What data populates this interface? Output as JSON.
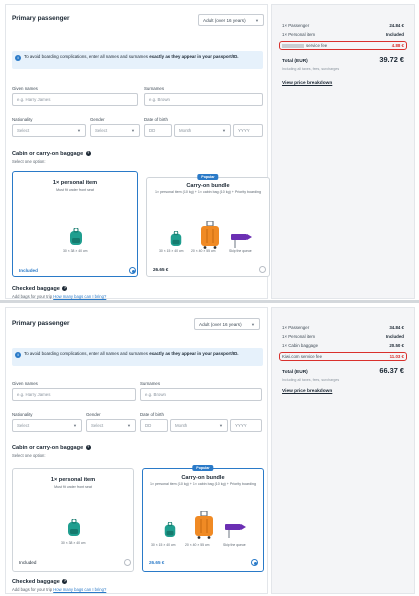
{
  "colors": {
    "accent": "#2a7ac8",
    "highlight": "#d9302c",
    "sidebar_bg": "#f4f5f7"
  },
  "icons": [
    "info-icon",
    "help-icon",
    "backpack-icon",
    "trolley-icon",
    "queue-tag-icon",
    "chevron-down-icon"
  ],
  "panels": [
    {
      "form": {
        "section_title": "Primary passenger",
        "age_select": "Adult (over 16 years)",
        "info_text_pre": "To avoid boarding complications, enter all names and surnames ",
        "info_text_bold": "exactly as they appear in your passport/ID.",
        "given_names_label": "Given names",
        "given_names_placeholder": "e.g. Harry James",
        "surnames_label": "Surnames",
        "surnames_placeholder": "e.g. Brown",
        "nationality_label": "Nationality",
        "nationality_value": "Select",
        "gender_label": "Gender",
        "gender_value": "Select",
        "dob_label": "Date of birth",
        "dob_day": "DD",
        "dob_month": "Month",
        "dob_year": "YYYY",
        "cabin_title": "Cabin or carry-on baggage",
        "cabin_sub": "Select one option:",
        "options": [
          {
            "title": "1× personal item",
            "desc": "Must fit under front seat",
            "dims": "30 × 38 × 40 cm",
            "status": "Included"
          },
          {
            "badge": "Popular",
            "title": "Carry-on bundle",
            "desc": "1× personal item (10 kg) + 1× cabin bag (10 kg) + Priority boarding",
            "dims1": "30 × 15 × 40 cm",
            "dims2": "20 × 40 × 55 cm",
            "dims3": "Skip the queue",
            "price": "26.65 €"
          }
        ],
        "checked_title": "Checked baggage",
        "checked_sub": "Add bags for your trip",
        "checked_link": "How many bags can I bring?"
      },
      "summary": {
        "rows": [
          {
            "label": "1× Passenger",
            "value": "24.84 €"
          },
          {
            "label": "1× Personal item",
            "value": "Included"
          }
        ],
        "fee_label": "service fee",
        "fee_value": "4.88 €",
        "total_label": "Total (EUR)",
        "total_value": "39.72 €",
        "total_sub": "Including all taxes, fees, surcharges",
        "breakdown_link": "View price breakdown"
      }
    },
    {
      "form": {
        "section_title": "Primary passenger",
        "age_select": "Adult (over 16 years)",
        "info_text_pre": "To avoid boarding complications, enter all names and surnames ",
        "info_text_bold": "exactly as they appear in your passport/ID.",
        "given_names_label": "Given names",
        "given_names_placeholder": "e.g. Harry James",
        "surnames_label": "Surnames",
        "surnames_placeholder": "e.g. Brown",
        "nationality_label": "Nationality",
        "nationality_value": "Select",
        "gender_label": "Gender",
        "gender_value": "Select",
        "dob_label": "Date of birth",
        "dob_day": "DD",
        "dob_month": "Month",
        "dob_year": "YYYY",
        "cabin_title": "Cabin or carry-on baggage",
        "cabin_sub": "Select one option:",
        "options": [
          {
            "title": "1× personal item",
            "desc": "Must fit under front seat",
            "dims": "30 × 38 × 40 cm",
            "status": "Included"
          },
          {
            "badge": "Popular",
            "title": "Carry-on bundle",
            "desc": "1× personal item (10 kg) + 1× cabin bag (10 kg) + Priority boarding",
            "dims1": "30 × 15 × 40 cm",
            "dims2": "20 × 40 × 55 cm",
            "dims3": "Skip the queue",
            "price": "26.65 €"
          }
        ],
        "checked_title": "Checked baggage",
        "checked_sub": "Add bags for your trip",
        "checked_link": "How many bags can I bring?"
      },
      "summary": {
        "rows": [
          {
            "label": "1× Passenger",
            "value": "34.84 €"
          },
          {
            "label": "1× Personal item",
            "value": "Included"
          },
          {
            "label": "1× Cabin baggage",
            "value": "20.50 €"
          }
        ],
        "fee_label": "Kiwi.com service fee",
        "fee_value": "11.03 €",
        "total_label": "Total (EUR)",
        "total_value": "66.37 €",
        "total_sub": "Including all taxes, fees, surcharges",
        "breakdown_link": "View price breakdown"
      }
    }
  ]
}
